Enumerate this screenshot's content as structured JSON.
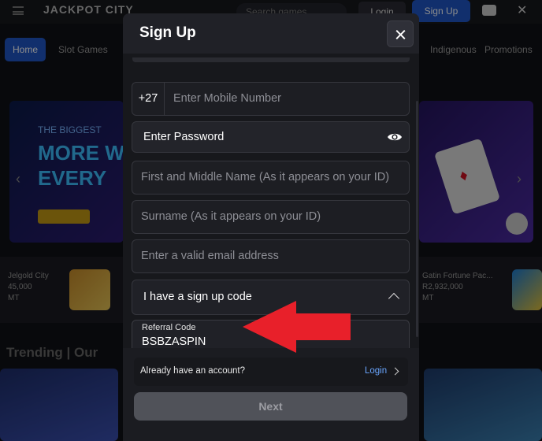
{
  "background": {
    "logo": "JACKPOT CITY",
    "search_placeholder": "Search games",
    "login_label": "Login",
    "signup_label": "Sign Up",
    "nav": [
      "Home",
      "Slot Games",
      "Indigenous",
      "Promotions"
    ],
    "hero_left_small": "THE BIGGEST",
    "hero_left_big": "MORE W\nEVERY",
    "strip_left": [
      "Jelgold City",
      "45,000",
      "MT"
    ],
    "strip_right": [
      "Gatin Fortune Pac...",
      "R2,932,000",
      "MT"
    ],
    "trending": "Trending | Our"
  },
  "modal": {
    "title": "Sign Up",
    "mobile": {
      "prefix": "+27",
      "placeholder": "Enter Mobile Number"
    },
    "password": {
      "value": "Enter Password"
    },
    "first_name": {
      "placeholder": "First and Middle Name (As it appears on your ID)"
    },
    "surname": {
      "placeholder": "Surname (As it appears on your ID)"
    },
    "email": {
      "placeholder": "Enter a valid email address"
    },
    "code_toggle": {
      "label": "I have a sign up code"
    },
    "referral": {
      "label": "Referral Code",
      "value": "BSBZASPIN"
    },
    "footer": {
      "question": "Already have an account?",
      "login_link": "Login",
      "next_label": "Next"
    }
  },
  "colors": {
    "accent_blue": "#1f56c6",
    "link_blue": "#6aa6ff",
    "annotation_red": "#e8202a",
    "modal_bg": "#1b1c21"
  }
}
